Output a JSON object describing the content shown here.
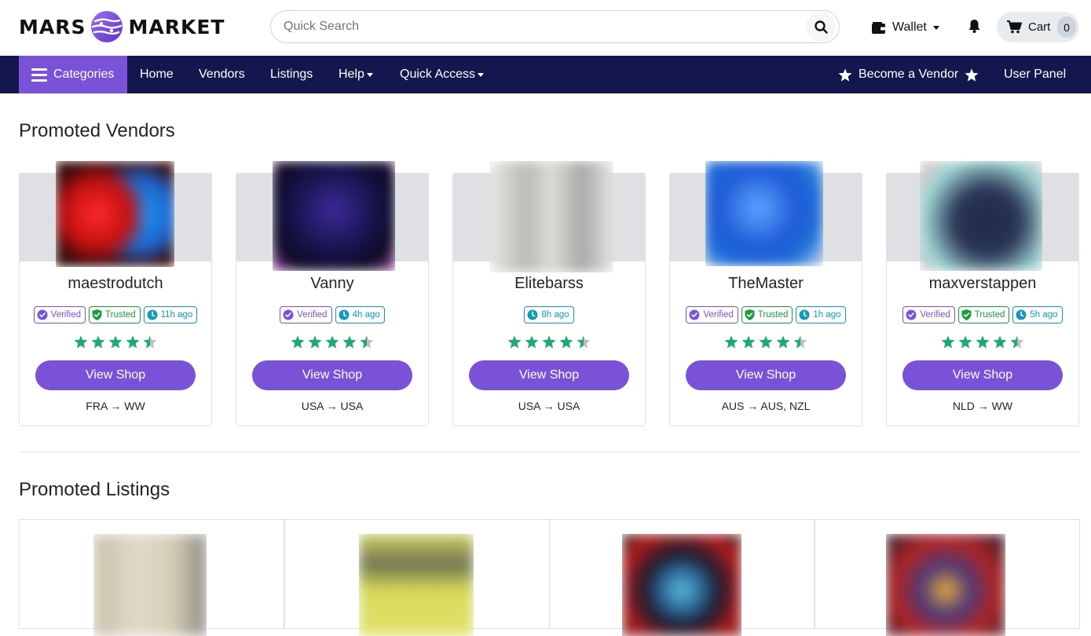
{
  "brand": {
    "left": "MARS",
    "right": "MARKET"
  },
  "search": {
    "placeholder": "Quick Search"
  },
  "header": {
    "wallet_label": "Wallet",
    "cart_label": "Cart",
    "cart_count": "0"
  },
  "nav": {
    "categories_label": "Categories",
    "items": [
      "Home",
      "Vendors",
      "Listings",
      "Help",
      "Quick Access"
    ],
    "become_vendor_label": "Become a Vendor",
    "user_panel_label": "User Panel"
  },
  "promoted_vendors": {
    "title": "Promoted Vendors",
    "view_shop_label": "View Shop",
    "vendors": [
      {
        "name": "maestrodutch",
        "badges": {
          "verified": "Verified",
          "trusted": "Trusted",
          "last_seen": "11h ago"
        },
        "rating": 4.5,
        "shipping": "FRA → WW"
      },
      {
        "name": "Vanny",
        "badges": {
          "verified": "Verified",
          "last_seen": "4h ago"
        },
        "rating": 4.5,
        "shipping": "USA → USA"
      },
      {
        "name": "Elitebarss",
        "badges": {
          "last_seen": "8h ago"
        },
        "rating": 4.5,
        "shipping": "USA → USA"
      },
      {
        "name": "TheMaster",
        "badges": {
          "verified": "Verified",
          "trusted": "Trusted",
          "last_seen": "1h ago"
        },
        "rating": 4.5,
        "shipping": "AUS → AUS, NZL"
      },
      {
        "name": "maxverstappen",
        "badges": {
          "verified": "Verified",
          "trusted": "Trusted",
          "last_seen": "5h ago"
        },
        "rating": 4.5,
        "shipping": "NLD → WW"
      }
    ]
  },
  "promoted_listings": {
    "title": "Promoted Listings"
  },
  "colors": {
    "accent": "#7952d8",
    "navbar": "#13174d",
    "star": "#1fa974",
    "trusted": "#1a9c3c",
    "time": "#1499b8"
  },
  "icons": [
    "planet-logo-icon",
    "search-icon",
    "wallet-icon",
    "bell-icon",
    "cart-icon",
    "hamburger-icon",
    "star-icon",
    "verified-icon",
    "shield-check-icon",
    "clock-icon"
  ]
}
